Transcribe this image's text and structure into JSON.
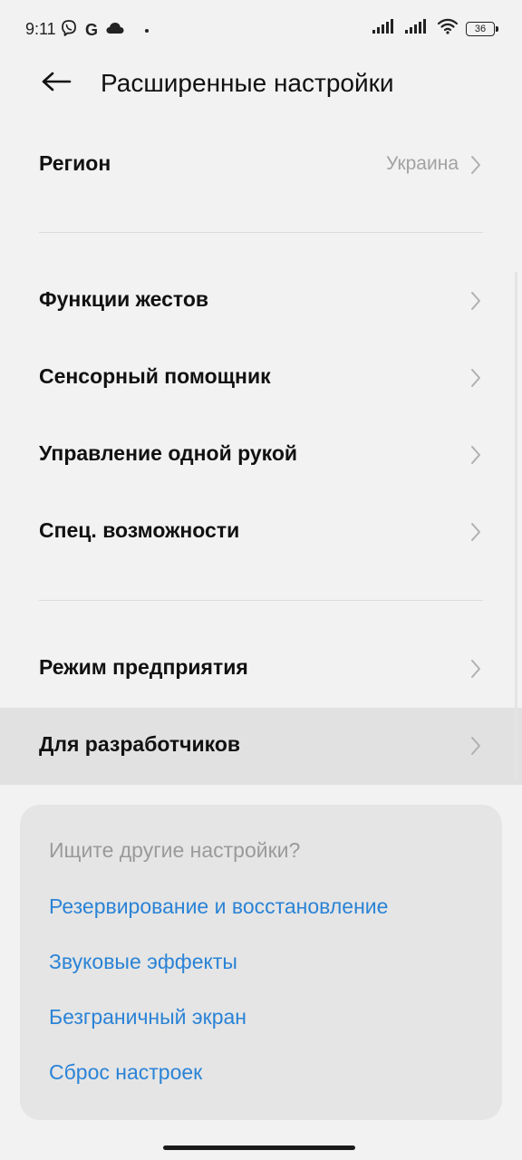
{
  "status_bar": {
    "time": "9:11",
    "g_label": "G",
    "battery": "36"
  },
  "header": {
    "title": "Расширенные настройки"
  },
  "rows": [
    {
      "label": "Регион",
      "value": "Украина"
    },
    {
      "label": "Функции жестов"
    },
    {
      "label": "Сенсорный помощник"
    },
    {
      "label": "Управление одной рукой"
    },
    {
      "label": "Спец. возможности"
    },
    {
      "label": "Режим предприятия"
    },
    {
      "label": "Для разработчиков"
    }
  ],
  "suggestions": {
    "heading": "Ищите другие настройки?",
    "links": [
      "Резервирование и восстановление",
      "Звуковые эффекты",
      "Безграничный экран",
      "Сброс настроек"
    ]
  },
  "colors": {
    "background": "#f2f2f2",
    "link": "#2a83d6",
    "secondary_text": "#a2a2a2",
    "highlight": "#e1e1e1"
  }
}
